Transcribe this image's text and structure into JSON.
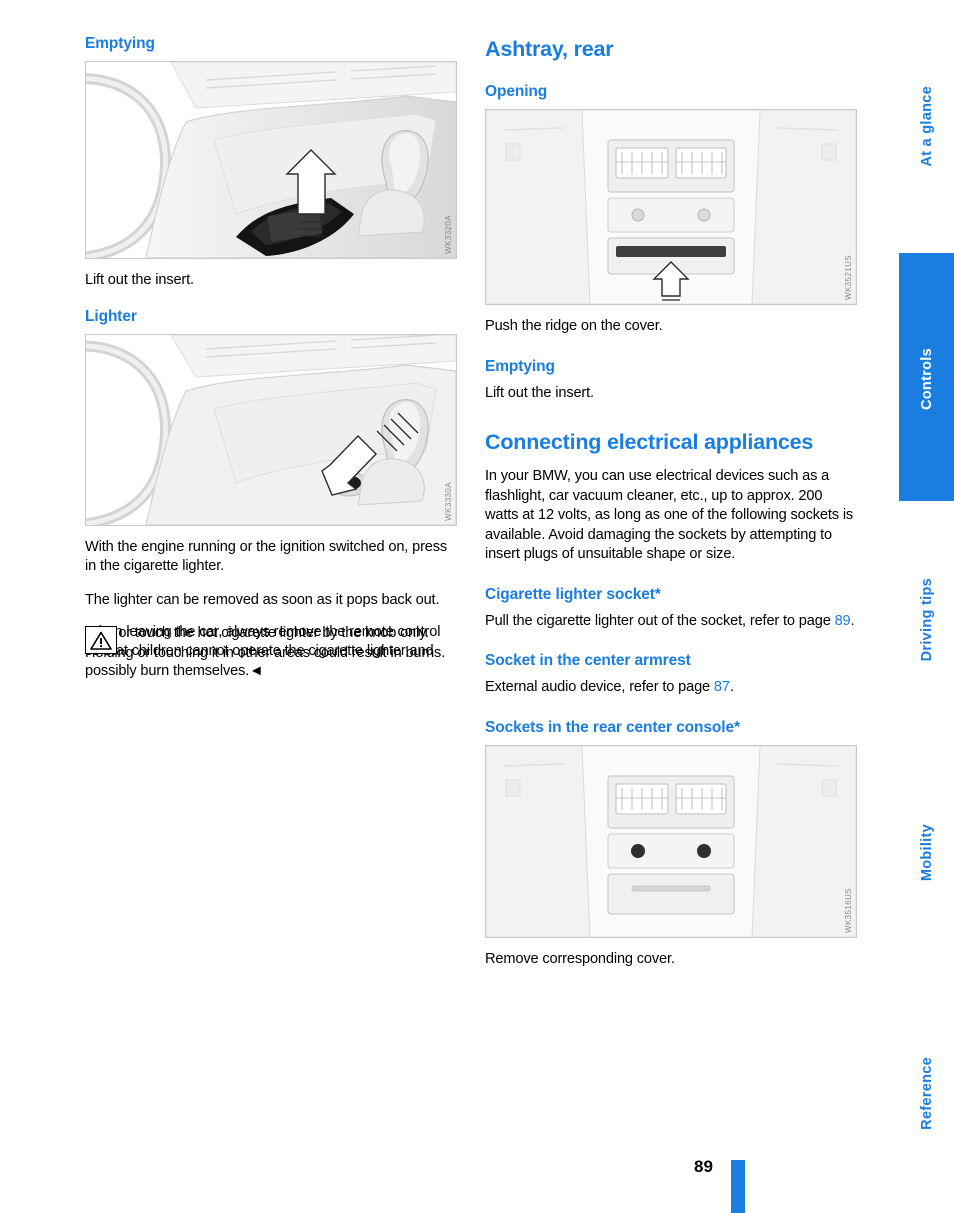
{
  "page": {
    "number": "89"
  },
  "left_column": {
    "emptying_heading": "Emptying",
    "figure1_code": "WK3320A",
    "emptying_text": "Lift out the insert.",
    "lighter_heading": "Lighter",
    "figure2_code": "WK3330A",
    "lighter_text1": "With the engine running or the ignition switched on, press in the cigarette lighter.",
    "lighter_text2": "The lighter can be removed as soon as it pops back out.",
    "warning_text1": "Hold or touch the hot cigarette lighter by the knob only. Holding or touching it in other areas could result in burns.",
    "warning_text2": "When leaving the car, always remove the remote control so that children cannot operate the cigarette lighter and possibly burn themselves."
  },
  "right_column": {
    "ashtray_heading": "Ashtray, rear",
    "opening_heading": "Opening",
    "figure3_code": "WK3521US",
    "opening_text": "Push the ridge on the cover.",
    "emptying_heading": "Emptying",
    "emptying_text": "Lift out the insert.",
    "connecting_heading": "Connecting electrical appliances",
    "connecting_text": "In your BMW, you can use electrical devices such as a flashlight, car vacuum cleaner, etc., up to approx. 200 watts at 12 volts, as long as one of the following sockets is available. Avoid damaging the sockets by attempting to insert plugs of unsuitable shape or size.",
    "cig_socket_heading": "Cigarette lighter socket*",
    "cig_socket_text_before": "Pull the cigarette lighter out of the socket, refer to page ",
    "cig_socket_page": "89",
    "cig_socket_text_after": ".",
    "armrest_heading": "Socket in the center armrest",
    "armrest_text_before": "External audio device, refer to page ",
    "armrest_page": "87",
    "armrest_text_after": ".",
    "rear_console_heading": "Sockets in the rear center console*",
    "figure4_code": "WK3516US",
    "rear_console_text": "Remove corresponding cover."
  },
  "tabs": [
    {
      "label": "At a glance",
      "style": "white"
    },
    {
      "label": "Controls",
      "style": "blue"
    },
    {
      "label": "Driving tips",
      "style": "white"
    },
    {
      "label": "Mobility",
      "style": "white"
    },
    {
      "label": "Reference",
      "style": "white"
    }
  ],
  "colors": {
    "accent": "#1a7de0",
    "text": "#000000"
  }
}
